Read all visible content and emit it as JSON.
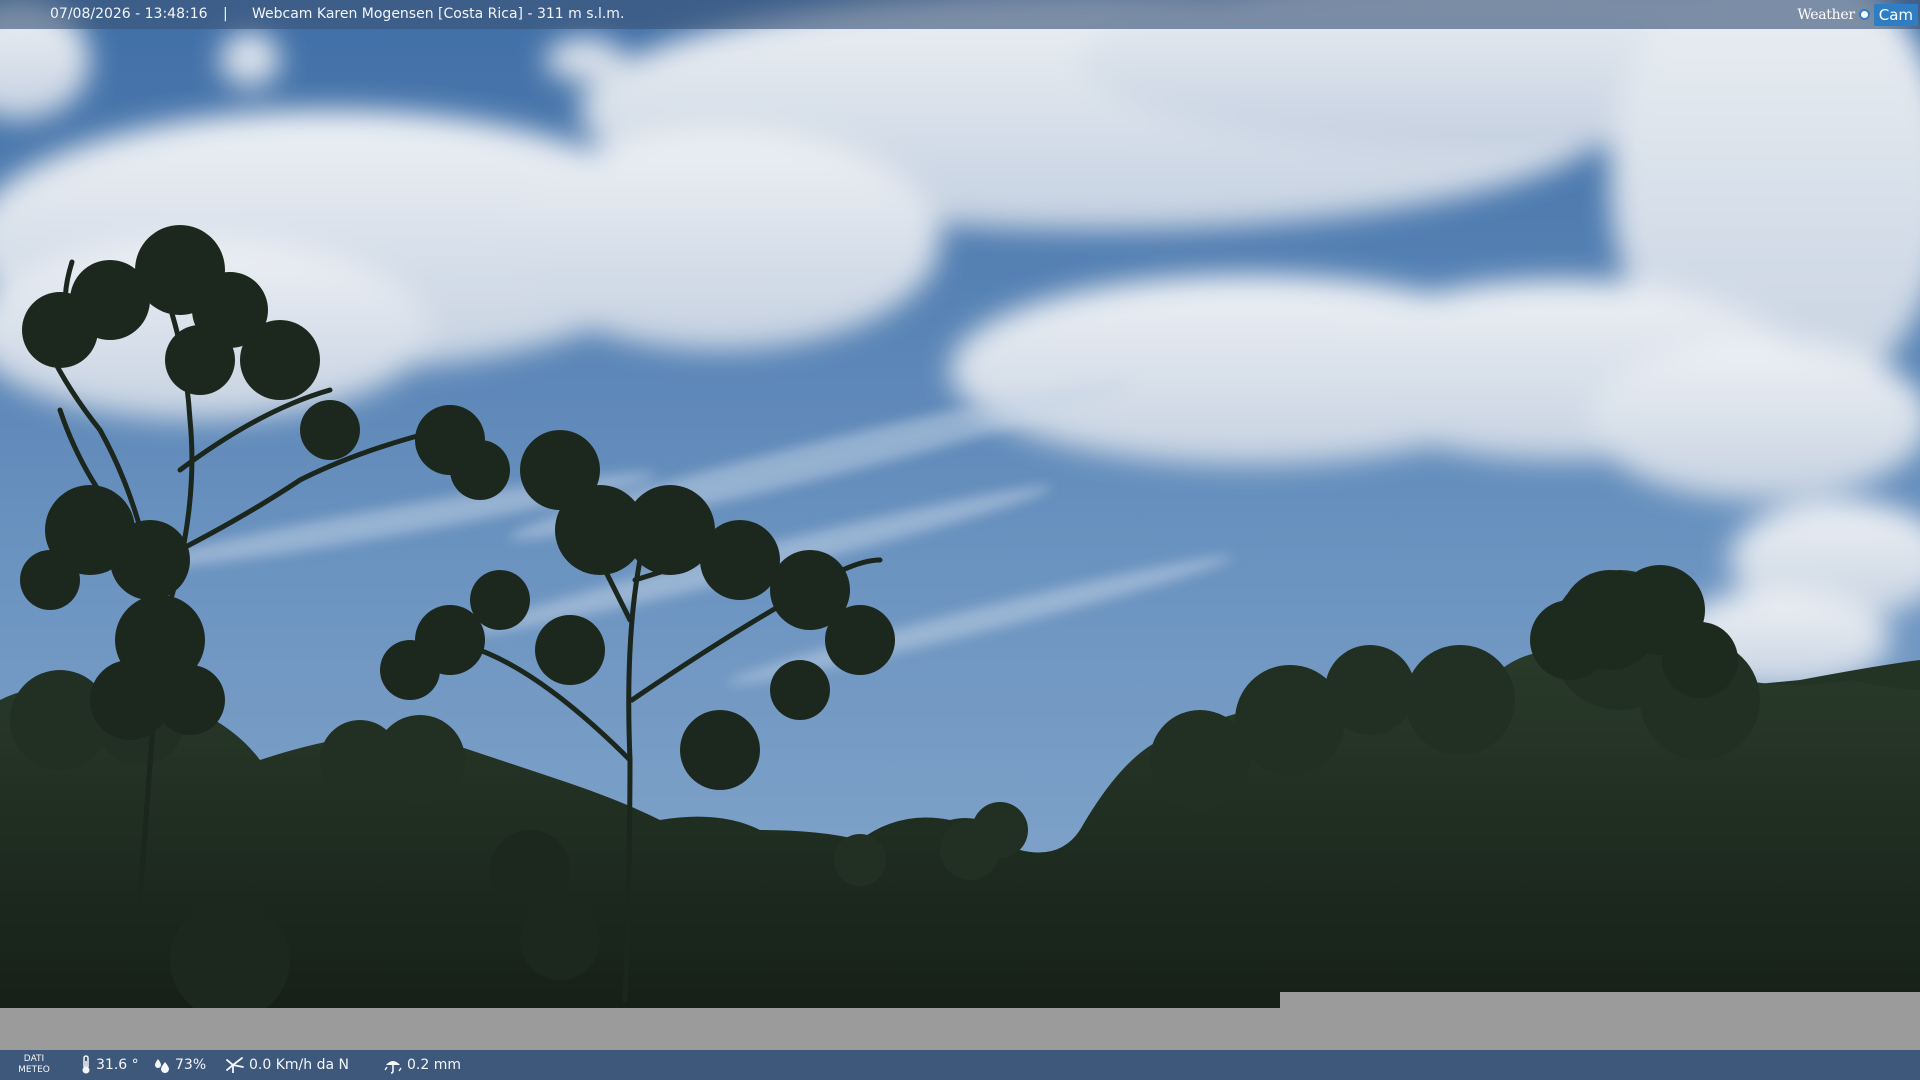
{
  "overlay": {
    "timestamp": "07/08/2026 - 13:48:16",
    "separator": "|",
    "title": "Webcam Karen Mogensen [Costa Rica] - 311 m s.l.m."
  },
  "brand": {
    "weather": "Weather",
    "cam": "Cam",
    "logo_icon": "sun-dot-icon"
  },
  "meteo": {
    "label_line1": "DATI",
    "label_line2": "METEO",
    "temperature": {
      "icon": "thermometer-icon",
      "value": "31.6 °"
    },
    "humidity": {
      "icon": "humidity-drops-icon",
      "value": "73%"
    },
    "wind": {
      "icon": "wind-icon",
      "value": "0.0 Km/h da N"
    },
    "rain": {
      "icon": "rain-icon",
      "value": "0.2 mm"
    }
  },
  "colors": {
    "sky_top": "#3f6ea6",
    "sky_bottom": "#7ea3c9",
    "foliage_dark": "#1c2a1d",
    "bar_bottom": "#3e587c",
    "brand_blue": "#2f7dc2"
  }
}
